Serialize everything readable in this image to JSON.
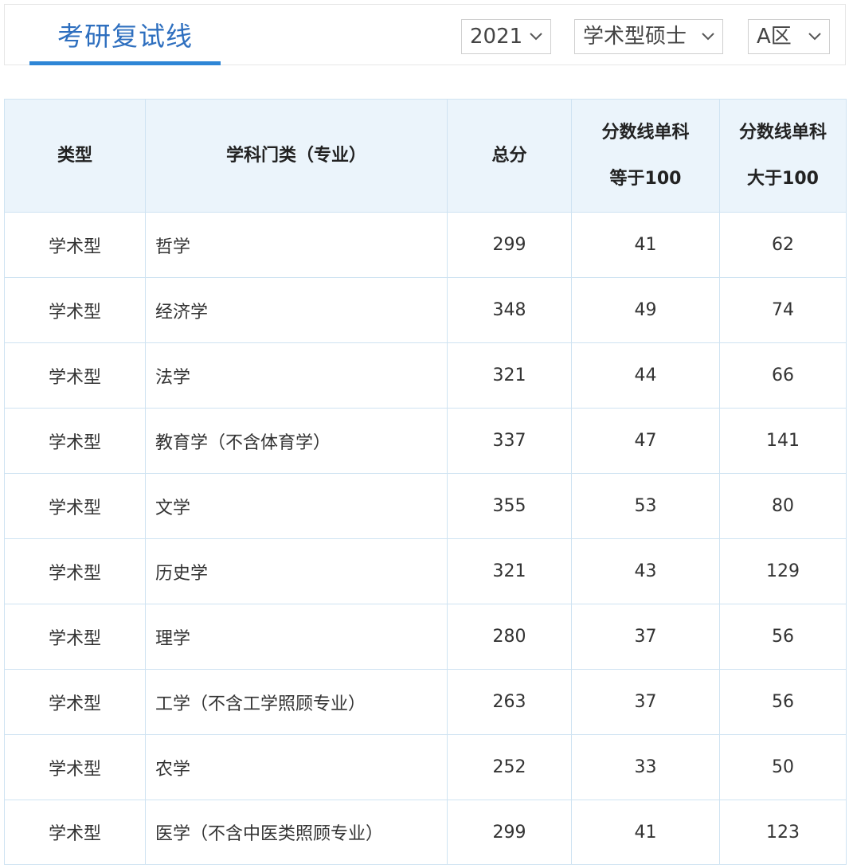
{
  "header": {
    "title": "考研复试线",
    "filters": {
      "year": "2021",
      "degree_type": "学术型硕士",
      "region": "A区"
    },
    "accent_color": "#2e86d6"
  },
  "table": {
    "columns": [
      "类型",
      "学科门类（专业）",
      "总分",
      "分数线单科等于100",
      "分数线单科大于100"
    ],
    "rows": [
      {
        "type": "学术型",
        "subject": "哲学",
        "total": "299",
        "eq100": "41",
        "gt100": "62"
      },
      {
        "type": "学术型",
        "subject": "经济学",
        "total": "348",
        "eq100": "49",
        "gt100": "74"
      },
      {
        "type": "学术型",
        "subject": "法学",
        "total": "321",
        "eq100": "44",
        "gt100": "66"
      },
      {
        "type": "学术型",
        "subject": "教育学（不含体育学）",
        "total": "337",
        "eq100": "47",
        "gt100": "141"
      },
      {
        "type": "学术型",
        "subject": "文学",
        "total": "355",
        "eq100": "53",
        "gt100": "80"
      },
      {
        "type": "学术型",
        "subject": "历史学",
        "total": "321",
        "eq100": "43",
        "gt100": "129"
      },
      {
        "type": "学术型",
        "subject": "理学",
        "total": "280",
        "eq100": "37",
        "gt100": "56"
      },
      {
        "type": "学术型",
        "subject": "工学（不含工学照顾专业）",
        "total": "263",
        "eq100": "37",
        "gt100": "56"
      },
      {
        "type": "学术型",
        "subject": "农学",
        "total": "252",
        "eq100": "33",
        "gt100": "50"
      },
      {
        "type": "学术型",
        "subject": "医学（不含中医类照顾专业）",
        "total": "299",
        "eq100": "41",
        "gt100": "123"
      }
    ]
  }
}
